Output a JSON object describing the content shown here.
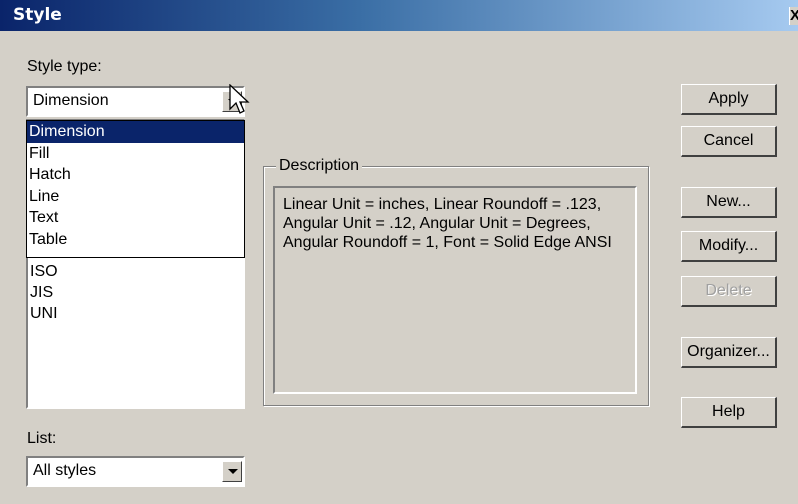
{
  "window": {
    "title": "Style",
    "close_label": "X"
  },
  "style_type": {
    "label": "Style type:",
    "selected": "Dimension",
    "options": [
      "Dimension",
      "Fill",
      "Hatch",
      "Line",
      "Text",
      "Table"
    ]
  },
  "styles_list": {
    "items": [
      "ISO",
      "JIS",
      "UNI"
    ]
  },
  "list_filter": {
    "label": "List:",
    "selected": "All styles"
  },
  "description": {
    "label": "Description",
    "text": "Linear Unit = inches, Linear Roundoff = .123, Angular Unit = .12, Angular Unit = Degrees, Angular Roundoff = 1, Font = Solid Edge ANSI"
  },
  "buttons": {
    "apply": "Apply",
    "cancel": "Cancel",
    "new": "New...",
    "modify": "Modify...",
    "delete": "Delete",
    "organizer": "Organizer...",
    "help": "Help"
  },
  "colors": {
    "dialog_bg": "#d4d0c8",
    "selection": "#0a246a",
    "title_start": "#0a246a",
    "title_end": "#a6caf0"
  }
}
